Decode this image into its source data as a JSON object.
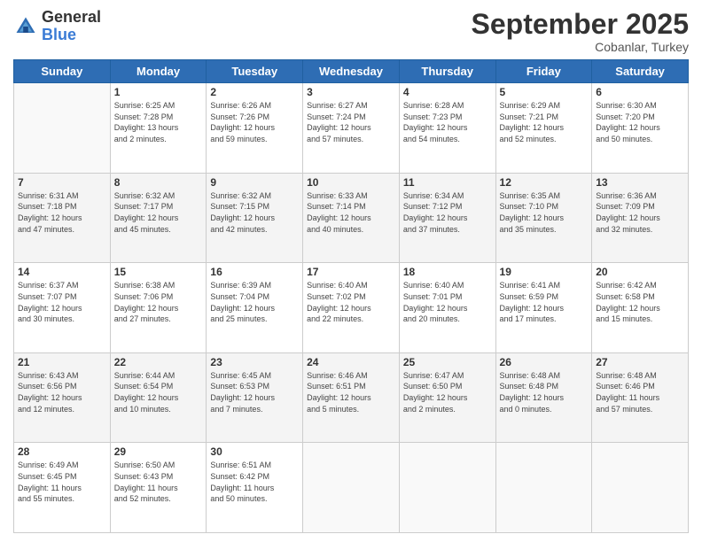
{
  "header": {
    "logo_general": "General",
    "logo_blue": "Blue",
    "month_title": "September 2025",
    "location": "Cobanlar, Turkey"
  },
  "days_of_week": [
    "Sunday",
    "Monday",
    "Tuesday",
    "Wednesday",
    "Thursday",
    "Friday",
    "Saturday"
  ],
  "weeks": [
    [
      {
        "day": "",
        "info": ""
      },
      {
        "day": "1",
        "info": "Sunrise: 6:25 AM\nSunset: 7:28 PM\nDaylight: 13 hours\nand 2 minutes."
      },
      {
        "day": "2",
        "info": "Sunrise: 6:26 AM\nSunset: 7:26 PM\nDaylight: 12 hours\nand 59 minutes."
      },
      {
        "day": "3",
        "info": "Sunrise: 6:27 AM\nSunset: 7:24 PM\nDaylight: 12 hours\nand 57 minutes."
      },
      {
        "day": "4",
        "info": "Sunrise: 6:28 AM\nSunset: 7:23 PM\nDaylight: 12 hours\nand 54 minutes."
      },
      {
        "day": "5",
        "info": "Sunrise: 6:29 AM\nSunset: 7:21 PM\nDaylight: 12 hours\nand 52 minutes."
      },
      {
        "day": "6",
        "info": "Sunrise: 6:30 AM\nSunset: 7:20 PM\nDaylight: 12 hours\nand 50 minutes."
      }
    ],
    [
      {
        "day": "7",
        "info": "Sunrise: 6:31 AM\nSunset: 7:18 PM\nDaylight: 12 hours\nand 47 minutes."
      },
      {
        "day": "8",
        "info": "Sunrise: 6:32 AM\nSunset: 7:17 PM\nDaylight: 12 hours\nand 45 minutes."
      },
      {
        "day": "9",
        "info": "Sunrise: 6:32 AM\nSunset: 7:15 PM\nDaylight: 12 hours\nand 42 minutes."
      },
      {
        "day": "10",
        "info": "Sunrise: 6:33 AM\nSunset: 7:14 PM\nDaylight: 12 hours\nand 40 minutes."
      },
      {
        "day": "11",
        "info": "Sunrise: 6:34 AM\nSunset: 7:12 PM\nDaylight: 12 hours\nand 37 minutes."
      },
      {
        "day": "12",
        "info": "Sunrise: 6:35 AM\nSunset: 7:10 PM\nDaylight: 12 hours\nand 35 minutes."
      },
      {
        "day": "13",
        "info": "Sunrise: 6:36 AM\nSunset: 7:09 PM\nDaylight: 12 hours\nand 32 minutes."
      }
    ],
    [
      {
        "day": "14",
        "info": "Sunrise: 6:37 AM\nSunset: 7:07 PM\nDaylight: 12 hours\nand 30 minutes."
      },
      {
        "day": "15",
        "info": "Sunrise: 6:38 AM\nSunset: 7:06 PM\nDaylight: 12 hours\nand 27 minutes."
      },
      {
        "day": "16",
        "info": "Sunrise: 6:39 AM\nSunset: 7:04 PM\nDaylight: 12 hours\nand 25 minutes."
      },
      {
        "day": "17",
        "info": "Sunrise: 6:40 AM\nSunset: 7:02 PM\nDaylight: 12 hours\nand 22 minutes."
      },
      {
        "day": "18",
        "info": "Sunrise: 6:40 AM\nSunset: 7:01 PM\nDaylight: 12 hours\nand 20 minutes."
      },
      {
        "day": "19",
        "info": "Sunrise: 6:41 AM\nSunset: 6:59 PM\nDaylight: 12 hours\nand 17 minutes."
      },
      {
        "day": "20",
        "info": "Sunrise: 6:42 AM\nSunset: 6:58 PM\nDaylight: 12 hours\nand 15 minutes."
      }
    ],
    [
      {
        "day": "21",
        "info": "Sunrise: 6:43 AM\nSunset: 6:56 PM\nDaylight: 12 hours\nand 12 minutes."
      },
      {
        "day": "22",
        "info": "Sunrise: 6:44 AM\nSunset: 6:54 PM\nDaylight: 12 hours\nand 10 minutes."
      },
      {
        "day": "23",
        "info": "Sunrise: 6:45 AM\nSunset: 6:53 PM\nDaylight: 12 hours\nand 7 minutes."
      },
      {
        "day": "24",
        "info": "Sunrise: 6:46 AM\nSunset: 6:51 PM\nDaylight: 12 hours\nand 5 minutes."
      },
      {
        "day": "25",
        "info": "Sunrise: 6:47 AM\nSunset: 6:50 PM\nDaylight: 12 hours\nand 2 minutes."
      },
      {
        "day": "26",
        "info": "Sunrise: 6:48 AM\nSunset: 6:48 PM\nDaylight: 12 hours\nand 0 minutes."
      },
      {
        "day": "27",
        "info": "Sunrise: 6:48 AM\nSunset: 6:46 PM\nDaylight: 11 hours\nand 57 minutes."
      }
    ],
    [
      {
        "day": "28",
        "info": "Sunrise: 6:49 AM\nSunset: 6:45 PM\nDaylight: 11 hours\nand 55 minutes."
      },
      {
        "day": "29",
        "info": "Sunrise: 6:50 AM\nSunset: 6:43 PM\nDaylight: 11 hours\nand 52 minutes."
      },
      {
        "day": "30",
        "info": "Sunrise: 6:51 AM\nSunset: 6:42 PM\nDaylight: 11 hours\nand 50 minutes."
      },
      {
        "day": "",
        "info": ""
      },
      {
        "day": "",
        "info": ""
      },
      {
        "day": "",
        "info": ""
      },
      {
        "day": "",
        "info": ""
      }
    ]
  ]
}
